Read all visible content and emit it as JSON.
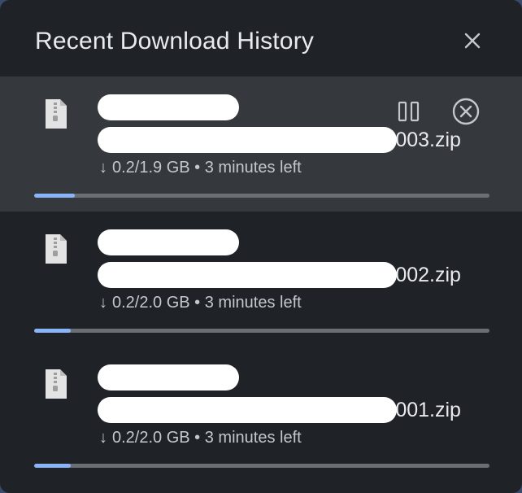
{
  "header": {
    "title": "Recent Download History",
    "close_icon": "close-icon"
  },
  "downloads": [
    {
      "name_suffix": "-003.zip",
      "arrow": "↓",
      "status": "0.2/1.9 GB • 3 minutes left",
      "progress": 0.09,
      "active": true,
      "actions": [
        "pause-icon",
        "cancel-icon"
      ]
    },
    {
      "name_suffix": "-002.zip",
      "arrow": "↓",
      "status": "0.2/2.0 GB • 3 minutes left",
      "progress": 0.08,
      "active": false
    },
    {
      "name_suffix": "-001.zip",
      "arrow": "↓",
      "status": "0.2/2.0 GB • 3 minutes left",
      "progress": 0.08,
      "active": false
    }
  ],
  "colors": {
    "panel_bg": "#1f2227",
    "active_row_bg": "#35383d",
    "progress_track": "#6b6e74",
    "progress_fill": "#8ab4f8",
    "text_primary": "#e8eaed",
    "text_secondary": "#c4c7cb"
  }
}
